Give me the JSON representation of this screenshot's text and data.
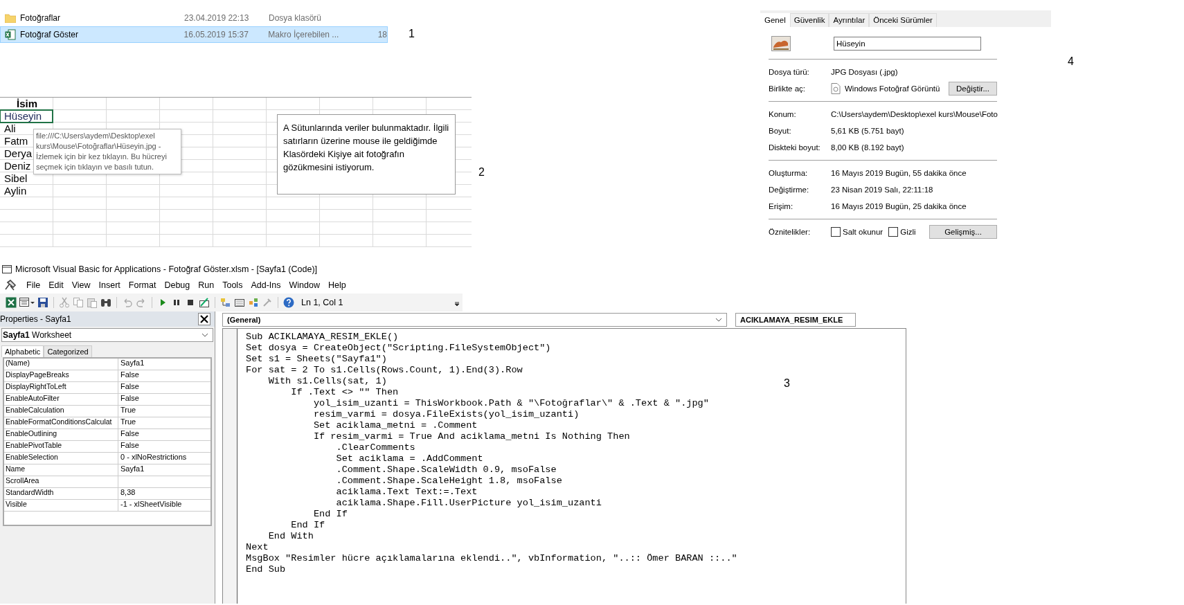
{
  "file_list": {
    "label": "1",
    "rows": [
      {
        "kind": "folder",
        "name": "Fotoğraflar",
        "modified": "23.04.2019 22:13",
        "type": "Dosya klasörü",
        "selected": false
      },
      {
        "kind": "excel",
        "name": "Fotoğraf Göster",
        "modified": "16.05.2019 15:37",
        "type": "Makro İçerebilen ...",
        "size": "18",
        "selected": true
      }
    ]
  },
  "sheet": {
    "label": "2",
    "header": "İsim",
    "cells": [
      {
        "text": "Hüseyin",
        "selected": true
      },
      {
        "text": "Ali",
        "selected": false
      },
      {
        "text": "Fatm",
        "selected": false
      },
      {
        "text": "Derya",
        "selected": false
      },
      {
        "text": "Deniz",
        "selected": false
      },
      {
        "text": "Sibel",
        "selected": false
      },
      {
        "text": "Aylin",
        "selected": false
      }
    ],
    "tooltip": "file:///C:\\Users\\aydem\\Desktop\\exel kurs\\Mouse\\Fotoğraflar\\Hüseyin.jpg - İzlemek için bir kez tıklayın. Bu hücreyi seçmek için tıklayın ve basılı tutun.",
    "comment": "A Sütunlarında veriler bulunmaktadır. İlgili satırların üzerine mouse ile geldiğimde  Klasördeki Kişiye ait fotoğrafın gözükmesini istiyorum."
  },
  "properties_dialog": {
    "label": "4",
    "tabs": [
      {
        "label": "Genel",
        "selected": true
      },
      {
        "label": "Güvenlik",
        "selected": false
      },
      {
        "label": "Ayrıntılar",
        "selected": false
      },
      {
        "label": "Önceki Sürümler",
        "selected": false
      }
    ],
    "file_name": "Hüseyin",
    "sections": [
      {
        "rows": [
          {
            "kind": "text",
            "label": "Dosya türü:",
            "value": "JPG Dosyası (.jpg)"
          },
          {
            "kind": "app",
            "label": "Birlikte aç:",
            "value": "Windows Fotoğraf Görüntü",
            "button": "Değiştir..."
          }
        ]
      },
      {
        "rows": [
          {
            "kind": "text",
            "label": "Konum:",
            "value": "C:\\Users\\aydem\\Desktop\\exel kurs\\Mouse\\Foto"
          },
          {
            "kind": "text",
            "label": "Boyut:",
            "value": "5,61 KB (5.751 bayt)"
          },
          {
            "kind": "text",
            "label": "Diskteki boyut:",
            "value": "8,00 KB (8.192 bayt)"
          }
        ]
      },
      {
        "rows": [
          {
            "kind": "text",
            "label": "Oluşturma:",
            "value": "16 Mayıs 2019 Bugün, 55 dakika önce"
          },
          {
            "kind": "text",
            "label": "Değiştirme:",
            "value": "23 Nisan 2019 Salı, 22:11:18"
          },
          {
            "kind": "text",
            "label": "Erişim:",
            "value": "16 Mayıs 2019 Bugün, 25 dakika önce"
          }
        ]
      }
    ],
    "attributes": {
      "label": "Öznitelikler:",
      "checkboxes": [
        {
          "label": "Salt okunur",
          "checked": false
        },
        {
          "label": "Gizli",
          "checked": false
        }
      ],
      "button": "Gelişmiş..."
    }
  },
  "vba": {
    "title": "Microsoft Visual Basic for Applications - Fotoğraf Göster.xlsm - [Sayfa1 (Code)]",
    "menus": [
      "File",
      "Edit",
      "View",
      "Insert",
      "Format",
      "Debug",
      "Run",
      "Tools",
      "Add-Ins",
      "Window",
      "Help"
    ],
    "position": "Ln 1, Col 1",
    "properties": {
      "title": "Properties - Sayfa1",
      "object": "**Sayfa1** Worksheet",
      "tabs": [
        {
          "label": "Alphabetic",
          "selected": true
        },
        {
          "label": "Categorized",
          "selected": false
        }
      ],
      "rows": [
        {
          "name": "(Name)",
          "value": "Sayfa1"
        },
        {
          "name": "DisplayPageBreaks",
          "value": "False"
        },
        {
          "name": "DisplayRightToLeft",
          "value": "False"
        },
        {
          "name": "EnableAutoFilter",
          "value": "False"
        },
        {
          "name": "EnableCalculation",
          "value": "True"
        },
        {
          "name": "EnableFormatConditionsCalculat",
          "value": "True"
        },
        {
          "name": "EnableOutlining",
          "value": "False"
        },
        {
          "name": "EnablePivotTable",
          "value": "False"
        },
        {
          "name": "EnableSelection",
          "value": "0 - xlNoRestrictions"
        },
        {
          "name": "Name",
          "value": "Sayfa1"
        },
        {
          "name": "ScrollArea"
        },
        {
          "name": "StandardWidth",
          "value": "8,38"
        },
        {
          "name": "Visible",
          "value": "-1 - xlSheetVisible"
        }
      ]
    },
    "code": {
      "object": "(General)",
      "procedure": "ACIKLAMAYA_RESIM_EKLE",
      "label": "3",
      "lines": [
        "Sub ACIKLAMAYA_RESIM_EKLE()",
        "Set dosya = CreateObject(\"Scripting.FileSystemObject\")",
        "Set s1 = Sheets(\"Sayfa1\")",
        "For sat = 2 To s1.Cells(Rows.Count, 1).End(3).Row",
        "    With s1.Cells(sat, 1)",
        "        If .Text <> \"\" Then",
        "            yol_isim_uzanti = ThisWorkbook.Path & \"\\Fotoğraflar\\\" & .Text & \".jpg\"",
        "            resim_varmi = dosya.FileExists(yol_isim_uzanti)",
        "            Set aciklama_metni = .Comment",
        "            If resim_varmi = True And aciklama_metni Is Nothing Then",
        "                .ClearComments",
        "                Set aciklama = .AddComment",
        "                .Comment.Shape.ScaleWidth 0.9, msoFalse",
        "                .Comment.Shape.ScaleHeight 1.8, msoFalse",
        "                aciklama.Text Text:=.Text",
        "                aciklama.Shape.Fill.UserPicture yol_isim_uzanti",
        "            End If",
        "        End If",
        "    End With",
        "Next",
        "MsgBox \"Resimler hücre açıklamalarına eklendi..\", vbInformation, \"..:: Ömer BARAN ::..\"",
        "End Sub"
      ]
    }
  }
}
